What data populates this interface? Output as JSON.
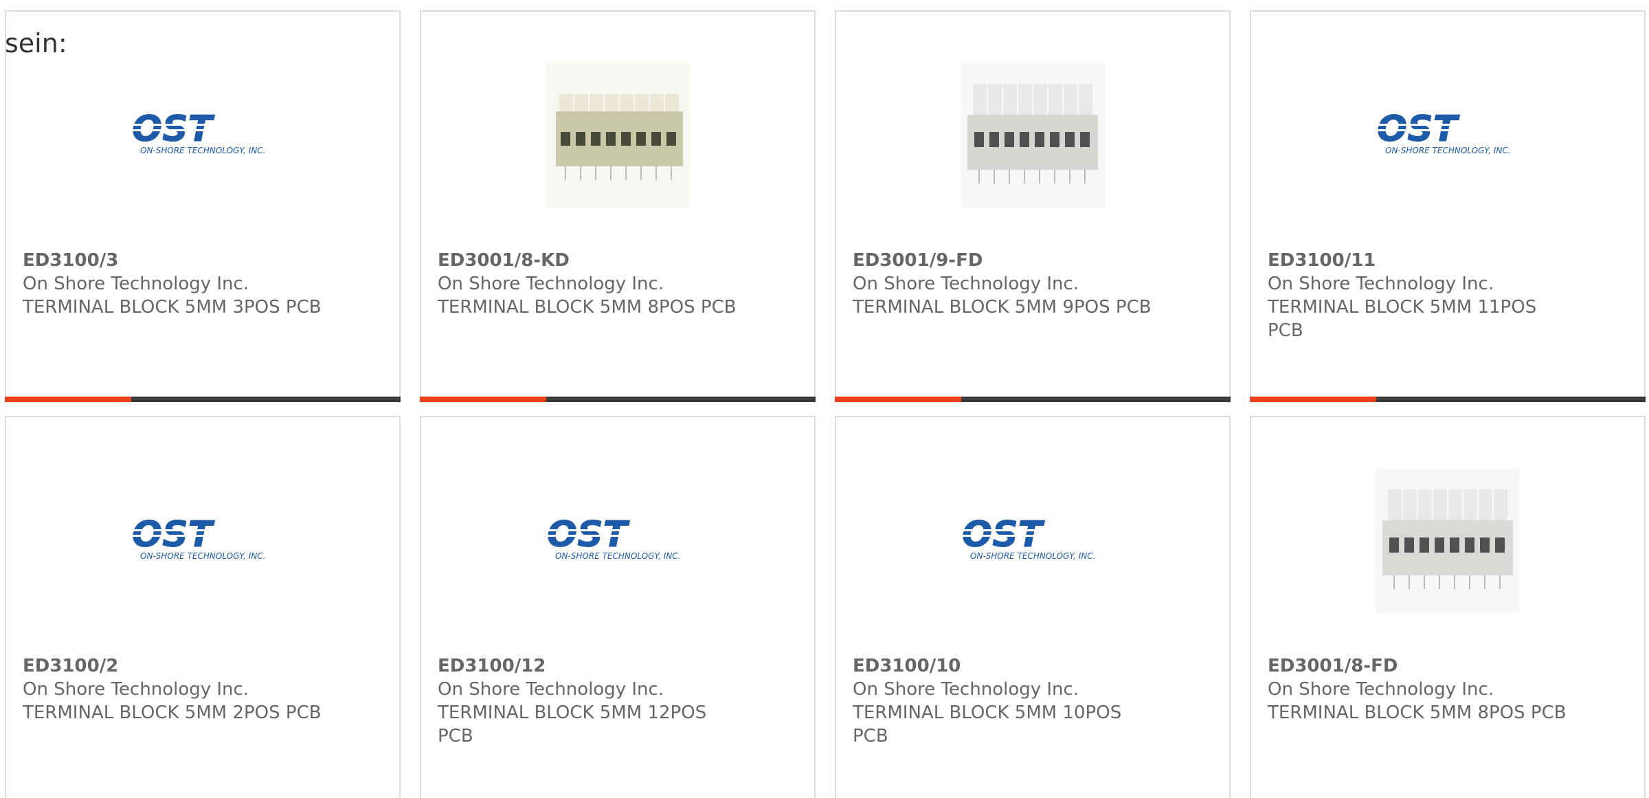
{
  "leading_text": "sein:",
  "logo": {
    "big_text": "OST",
    "small_text": "ON-SHORE TECHNOLOGY, INC."
  },
  "colors": {
    "accent": "#e8411b",
    "bar": "#3c3c3c",
    "logo_blue": "#1d5aa8",
    "text": "#666666",
    "border": "#dddddd"
  },
  "products": [
    {
      "part": "ED3100/3",
      "maker": "On Shore Technology Inc.",
      "desc": "TERMINAL BLOCK 5MM 3POS PCB",
      "image": "ost-logo"
    },
    {
      "part": "ED3001/8-KD",
      "maker": "On Shore Technology Inc.",
      "desc": "TERMINAL BLOCK 5MM 8POS PCB",
      "image": "terminal-block-photo"
    },
    {
      "part": "ED3001/9-FD",
      "maker": "On Shore Technology Inc.",
      "desc": "TERMINAL BLOCK 5MM 9POS PCB",
      "image": "terminal-block-photo"
    },
    {
      "part": "ED3100/11",
      "maker": "On Shore Technology Inc.",
      "desc": "TERMINAL BLOCK 5MM 11POS PCB",
      "image": "ost-logo"
    },
    {
      "part": "ED3100/2",
      "maker": "On Shore Technology Inc.",
      "desc": "TERMINAL BLOCK 5MM 2POS PCB",
      "image": "ost-logo"
    },
    {
      "part": "ED3100/12",
      "maker": "On Shore Technology Inc.",
      "desc": "TERMINAL BLOCK 5MM 12POS PCB",
      "image": "ost-logo"
    },
    {
      "part": "ED3100/10",
      "maker": "On Shore Technology Inc.",
      "desc": "TERMINAL BLOCK 5MM 10POS PCB",
      "image": "ost-logo"
    },
    {
      "part": "ED3001/8-FD",
      "maker": "On Shore Technology Inc.",
      "desc": "TERMINAL BLOCK 5MM 8POS PCB",
      "image": "terminal-block-photo"
    }
  ]
}
